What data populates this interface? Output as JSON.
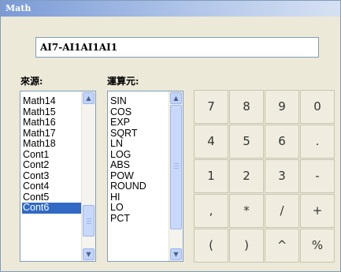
{
  "window": {
    "title": "Math"
  },
  "expression": {
    "value": "AI7-AI1AI1AI1"
  },
  "source": {
    "label": "來源:",
    "items": [
      "Math14",
      "Math15",
      "Math16",
      "Math17",
      "Math18",
      "Cont1",
      "Cont2",
      "Cont3",
      "Cont4",
      "Cont5",
      "Cont6"
    ],
    "selected": "Cont6"
  },
  "operators": {
    "label": "運算元:",
    "items": [
      "SIN",
      "COS",
      "EXP",
      "SQRT",
      "LN",
      "LOG",
      "ABS",
      "POW",
      "ROUND",
      "HI",
      "LO",
      "PCT"
    ]
  },
  "keypad": {
    "keys": [
      "7",
      "8",
      "9",
      "0",
      "4",
      "5",
      "6",
      ".",
      "1",
      "2",
      "3",
      "-",
      ",",
      "*",
      "/",
      "+",
      "(",
      ")",
      "^",
      "%"
    ]
  },
  "icons": {
    "scroll_up": "arrow-up-icon",
    "scroll_down": "arrow-down-icon"
  },
  "colors": {
    "selection": "#316ac5",
    "background": "#ece9d8"
  }
}
